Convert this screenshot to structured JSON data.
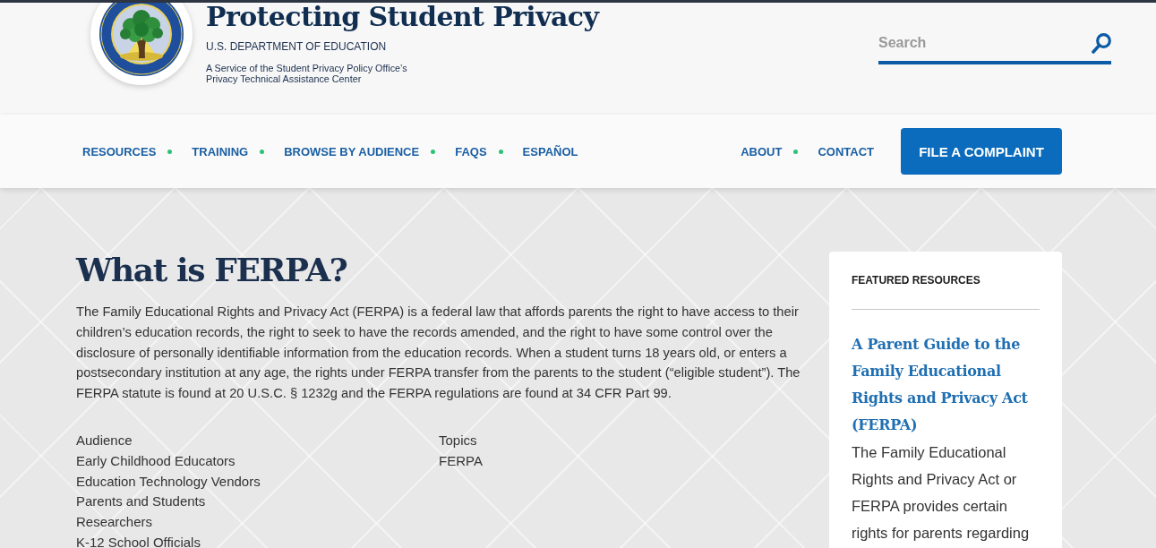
{
  "header": {
    "title": "Protecting Student Privacy",
    "department": "U.S. DEPARTMENT OF EDUCATION",
    "service": "A Service of the Student Privacy Policy Office’s Privacy Technical Assistance Center",
    "search": {
      "placeholder": "Search"
    }
  },
  "nav": {
    "primary": [
      {
        "label": "RESOURCES"
      },
      {
        "label": "TRAINING"
      },
      {
        "label": "BROWSE BY AUDIENCE"
      },
      {
        "label": "FAQS"
      },
      {
        "label": "ESPAÑOL"
      }
    ],
    "secondary": [
      {
        "label": "ABOUT"
      },
      {
        "label": "CONTACT"
      }
    ],
    "button": "FILE A COMPLAINT"
  },
  "article": {
    "title": "What is FERPA?",
    "body": "The Family Educational Rights and Privacy Act (FERPA) is a federal law that affords parents the right to have access to their children’s education records, the right to seek to have the records amended, and the right to have some control over the disclosure of personally identifiable information from the education records. When a student turns 18 years old, or enters a postsecondary institution at any age, the rights under FERPA transfer from the parents to the student (“eligible student”). The FERPA statute is found at 20 U.S.C. § 1232g and the FERPA regulations are found at 34 CFR Part 99.",
    "audience": {
      "heading": "Audience",
      "items": [
        "Early Childhood Educators",
        "Education Technology Vendors",
        "Parents and Students",
        "Researchers",
        "K-12 School Officials"
      ]
    },
    "topics": {
      "heading": "Topics",
      "items": [
        "FERPA"
      ]
    }
  },
  "featured": {
    "heading": "FEATURED RESOURCES",
    "items": [
      {
        "title": "A Parent Guide to the Family Educational Rights and Privacy Act (FERPA)",
        "description": "The Family Educational Rights and Privacy Act or FERPA provides certain rights for parents regarding"
      }
    ]
  }
}
